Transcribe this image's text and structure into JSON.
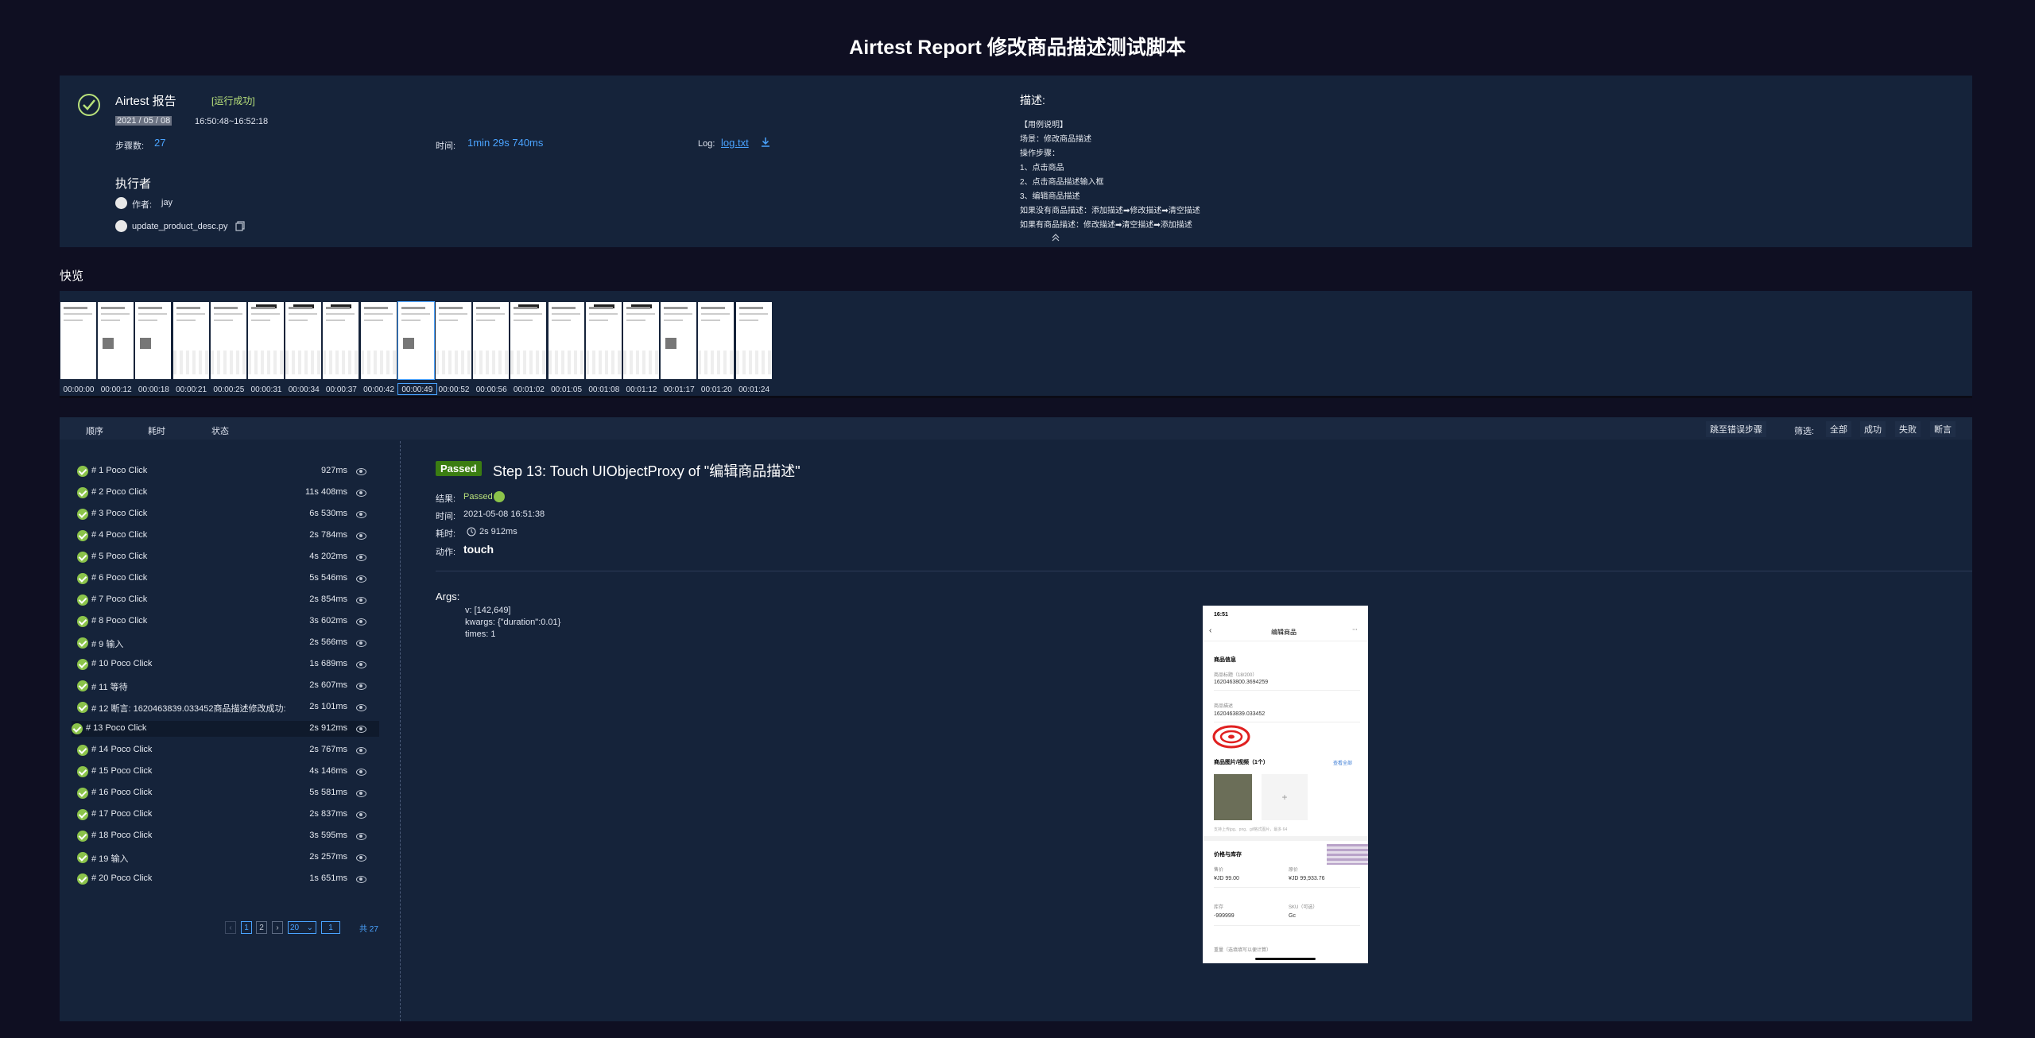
{
  "page_title": "Airtest Report 修改商品描述测试脚本",
  "summary": {
    "app_name": "Airtest 报告",
    "status": "[运行成功]",
    "date": "2021 / 05 / 08",
    "time_range": "16:50:48~16:52:18",
    "steps_label": "步骤数:",
    "steps_value": "27",
    "duration_label": "时间:",
    "duration_value": "1min 29s 740ms",
    "log_label": "Log:",
    "log_link": "log.txt",
    "executor_title": "执行者",
    "author_label": "作者:",
    "author_value": "jay",
    "script_name": "update_product_desc.py",
    "desc_title": "描述:",
    "desc_lines": [
      "【用例说明】",
      "场景：修改商品描述",
      "操作步骤：",
      "1、点击商品",
      "2、点击商品描述输入框",
      "3、编辑商品描述",
      "如果没有商品描述：添加描述➡修改描述➡清空描述",
      "如果有商品描述：修改描述➡清空描述➡添加描述"
    ]
  },
  "quick_view": {
    "title": "快览",
    "thumbs": [
      "00:00:00",
      "00:00:12",
      "00:00:18",
      "00:00:21",
      "00:00:25",
      "00:00:31",
      "00:00:34",
      "00:00:37",
      "00:00:42",
      "00:00:49",
      "00:00:52",
      "00:00:56",
      "00:01:02",
      "00:01:05",
      "00:01:08",
      "00:01:12",
      "00:01:17",
      "00:01:20",
      "00:01:24"
    ]
  },
  "toolbar": {
    "col_order": "顺序",
    "col_time": "耗时",
    "col_status": "状态",
    "jump_error": "跳至错误步骤",
    "filter_label": "筛选:",
    "filter_all": "全部",
    "filter_success": "成功",
    "filter_fail": "失败",
    "filter_assert": "断言"
  },
  "steps": [
    {
      "name": "# 1 Poco Click",
      "time": "927ms"
    },
    {
      "name": "# 2 Poco Click",
      "time": "11s 408ms"
    },
    {
      "name": "# 3 Poco Click",
      "time": "6s 530ms"
    },
    {
      "name": "# 4 Poco Click",
      "time": "2s 784ms"
    },
    {
      "name": "# 5 Poco Click",
      "time": "4s 202ms"
    },
    {
      "name": "# 6 Poco Click",
      "time": "5s 546ms"
    },
    {
      "name": "# 7 Poco Click",
      "time": "2s 854ms"
    },
    {
      "name": "# 8 Poco Click",
      "time": "3s 602ms"
    },
    {
      "name": "# 9 输入",
      "time": "2s 566ms"
    },
    {
      "name": "# 10 Poco Click",
      "time": "1s 689ms"
    },
    {
      "name": "# 11 等待",
      "time": "2s 607ms"
    },
    {
      "name": "# 12 断言:   1620463839.033452商品描述修改成功:",
      "time": "2s 101ms"
    },
    {
      "name": "# 13 Poco Click",
      "time": "2s 912ms"
    },
    {
      "name": "# 14 Poco Click",
      "time": "2s 767ms"
    },
    {
      "name": "# 15 Poco Click",
      "time": "4s 146ms"
    },
    {
      "name": "# 16 Poco Click",
      "time": "5s 581ms"
    },
    {
      "name": "# 17 Poco Click",
      "time": "2s 837ms"
    },
    {
      "name": "# 18 Poco Click",
      "time": "3s 595ms"
    },
    {
      "name": "# 19 输入",
      "time": "2s 257ms"
    },
    {
      "name": "# 20 Poco Click",
      "time": "1s 651ms"
    }
  ],
  "pagination": {
    "prev": "‹",
    "page1": "1",
    "page2": "2",
    "next": "›",
    "page_size": "20",
    "goto": "1",
    "total": "共 27"
  },
  "detail": {
    "badge": "Passed",
    "title": "Step 13: Touch UIObjectProxy of \"编辑商品描述\"",
    "result_label": "结果:",
    "result_value": "Passed",
    "time_label": "时间:",
    "time_value": "2021-05-08 16:51:38",
    "cost_label": "耗时:",
    "cost_value": "2s 912ms",
    "action_label": "动作:",
    "action_value": "touch",
    "args_title": "Args:",
    "args": [
      "v: [142,649]",
      "kwargs: {\"duration\":0.01}",
      "times: 1"
    ]
  },
  "phone": {
    "clock": "16:51",
    "header": "编辑商品",
    "section1": "商品信息",
    "f1_label": "商品标题（18/200）",
    "f1_value": "1620463800.3694259",
    "f2_label": "商品描述",
    "f2_value": "1620463839.033452",
    "section2": "商品图片/视频（1个）",
    "see_all": "查看全部",
    "hint": "支持上传jpg、png、gif格式图片，最多 64",
    "section3": "价格与库存",
    "price_label": "售价",
    "price_value": "¥JD 99.00",
    "orig_label": "原价",
    "orig_value": "¥JD 99,933.76",
    "stock_label": "库存",
    "stock_value": "-999999",
    "sku_label": "SKU（可选）",
    "sku_value": "Gc",
    "more": "重量（选填填写以便计算）"
  },
  "colors": {
    "background": "#0f0f22",
    "panel": "#15233a",
    "accent_blue": "#4aa3ff",
    "success_green": "#8bc34a",
    "passed_badge": "#3b7d12"
  }
}
